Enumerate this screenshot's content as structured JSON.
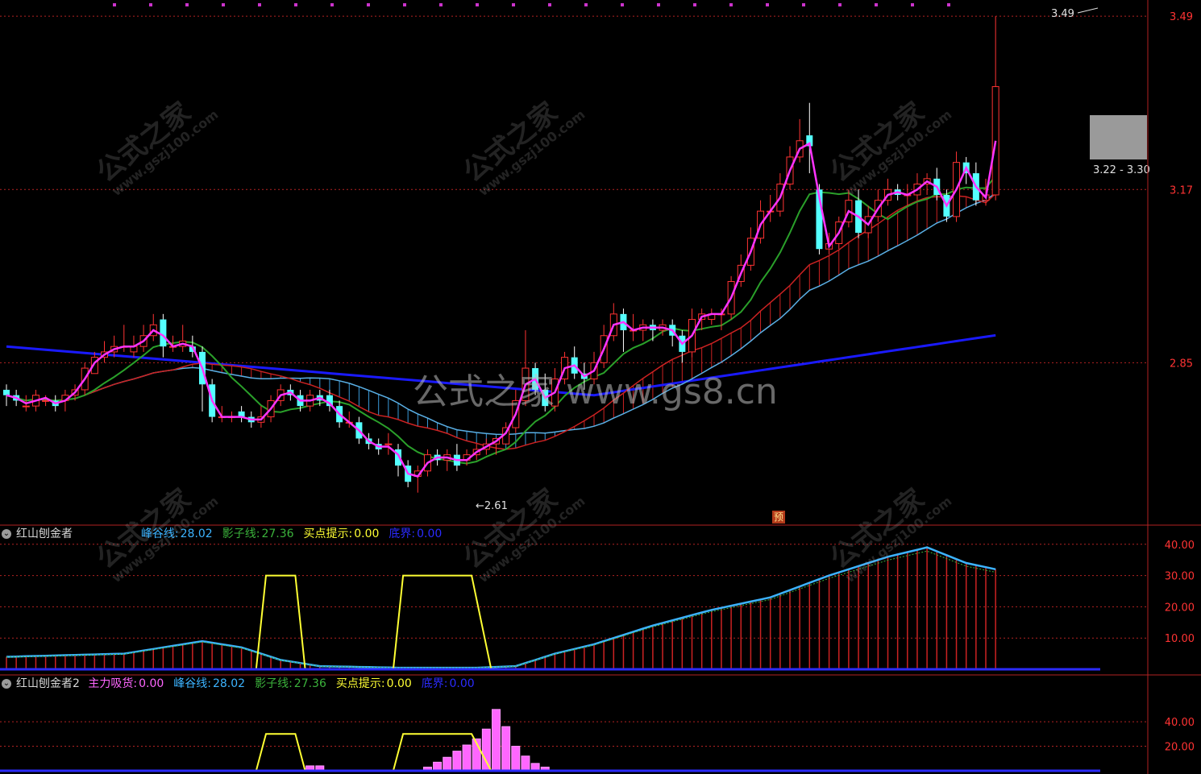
{
  "main_panel": {
    "price_axis_labels": [
      "3.49",
      "3.17",
      "2.85"
    ],
    "high_label": "3.49",
    "low_label": "2.61",
    "range_label": "3.22 - 3.30",
    "forecast_badge": "预"
  },
  "panel2": {
    "title": "红山刨金者",
    "indicators": [
      {
        "label": "峰谷线:",
        "value": "28.02",
        "color": "#3cb3ff"
      },
      {
        "label": "影子线:",
        "value": "27.36",
        "color": "#3bb23b"
      },
      {
        "label": "买点提示:",
        "value": "0.00",
        "color": "#ffff33"
      },
      {
        "label": "底界:",
        "value": "0.00",
        "color": "#2b2bff"
      }
    ],
    "axis_labels": [
      "40.00",
      "30.00",
      "20.00",
      "10.00"
    ]
  },
  "panel3": {
    "title": "红山刨金者2",
    "indicators": [
      {
        "label": "主力吸货:",
        "value": "0.00",
        "color": "#ff66ff"
      },
      {
        "label": "峰谷线:",
        "value": "28.02",
        "color": "#3cb3ff"
      },
      {
        "label": "影子线:",
        "value": "27.36",
        "color": "#3bb23b"
      },
      {
        "label": "买点提示:",
        "value": "0.00",
        "color": "#ffff33"
      },
      {
        "label": "底界:",
        "value": "0.00",
        "color": "#2b2bff"
      }
    ],
    "axis_labels": [
      "40.00",
      "20.00"
    ]
  },
  "watermarks": {
    "center": "公式之家 www.gs8.cn",
    "tile_main": "公式之家",
    "tile_sub": "www.gszj100.com"
  },
  "chart_data": [
    {
      "type": "candlestick",
      "ylim": [
        2.55,
        3.52
      ],
      "ticks": [
        3.49,
        3.17,
        2.85
      ],
      "candles": [
        [
          2.8,
          2.79,
          2.81,
          2.77
        ],
        [
          2.79,
          2.78,
          2.8,
          2.77
        ],
        [
          2.77,
          2.77,
          2.79,
          2.76
        ],
        [
          2.77,
          2.79,
          2.8,
          2.76
        ],
        [
          2.78,
          2.78,
          2.79,
          2.77
        ],
        [
          2.78,
          2.77,
          2.79,
          2.76
        ],
        [
          2.78,
          2.79,
          2.8,
          2.76
        ],
        [
          2.79,
          2.8,
          2.81,
          2.78
        ],
        [
          2.8,
          2.84,
          2.85,
          2.79
        ],
        [
          2.83,
          2.86,
          2.87,
          2.83
        ],
        [
          2.86,
          2.87,
          2.89,
          2.85
        ],
        [
          2.87,
          2.88,
          2.9,
          2.86
        ],
        [
          2.88,
          2.88,
          2.92,
          2.87
        ],
        [
          2.87,
          2.88,
          2.9,
          2.86
        ],
        [
          2.88,
          2.9,
          2.92,
          2.87
        ],
        [
          2.9,
          2.92,
          2.94,
          2.89
        ],
        [
          2.93,
          2.88,
          2.94,
          2.86
        ],
        [
          2.88,
          2.88,
          2.9,
          2.87
        ],
        [
          2.88,
          2.89,
          2.92,
          2.87
        ],
        [
          2.88,
          2.87,
          2.9,
          2.86
        ],
        [
          2.87,
          2.81,
          2.88,
          2.76
        ],
        [
          2.81,
          2.75,
          2.82,
          2.74
        ],
        [
          2.75,
          2.75,
          2.77,
          2.74
        ],
        [
          2.75,
          2.75,
          2.76,
          2.74
        ],
        [
          2.76,
          2.75,
          2.77,
          2.74
        ],
        [
          2.75,
          2.74,
          2.76,
          2.73
        ],
        [
          2.74,
          2.75,
          2.77,
          2.73
        ],
        [
          2.75,
          2.78,
          2.79,
          2.74
        ],
        [
          2.78,
          2.8,
          2.81,
          2.77
        ],
        [
          2.8,
          2.79,
          2.81,
          2.78
        ],
        [
          2.79,
          2.77,
          2.8,
          2.76
        ],
        [
          2.77,
          2.79,
          2.8,
          2.76
        ],
        [
          2.79,
          2.78,
          2.8,
          2.77
        ],
        [
          2.79,
          2.77,
          2.8,
          2.76
        ],
        [
          2.77,
          2.74,
          2.78,
          2.73
        ],
        [
          2.74,
          2.74,
          2.76,
          2.73
        ],
        [
          2.74,
          2.71,
          2.75,
          2.7
        ],
        [
          2.71,
          2.7,
          2.72,
          2.69
        ],
        [
          2.7,
          2.69,
          2.71,
          2.68
        ],
        [
          2.7,
          2.7,
          2.72,
          2.68
        ],
        [
          2.69,
          2.66,
          2.7,
          2.64
        ],
        [
          2.66,
          2.63,
          2.67,
          2.62
        ],
        [
          2.64,
          2.65,
          2.66,
          2.61
        ],
        [
          2.65,
          2.68,
          2.69,
          2.64
        ],
        [
          2.68,
          2.67,
          2.69,
          2.66
        ],
        [
          2.67,
          2.68,
          2.69,
          2.65
        ],
        [
          2.68,
          2.66,
          2.7,
          2.65
        ],
        [
          2.67,
          2.68,
          2.69,
          2.66
        ],
        [
          2.68,
          2.69,
          2.7,
          2.67
        ],
        [
          2.69,
          2.7,
          2.71,
          2.68
        ],
        [
          2.7,
          2.71,
          2.71,
          2.68
        ],
        [
          2.7,
          2.73,
          2.74,
          2.7
        ],
        [
          2.73,
          2.78,
          2.8,
          2.72
        ],
        [
          2.78,
          2.84,
          2.91,
          2.77
        ],
        [
          2.84,
          2.8,
          2.85,
          2.79
        ],
        [
          2.8,
          2.77,
          2.83,
          2.76
        ],
        [
          2.77,
          2.82,
          2.84,
          2.76
        ],
        [
          2.82,
          2.86,
          2.87,
          2.81
        ],
        [
          2.86,
          2.83,
          2.88,
          2.82
        ],
        [
          2.83,
          2.82,
          2.85,
          2.8
        ],
        [
          2.82,
          2.85,
          2.87,
          2.81
        ],
        [
          2.85,
          2.9,
          2.92,
          2.84
        ],
        [
          2.9,
          2.94,
          2.96,
          2.89
        ],
        [
          2.94,
          2.91,
          2.95,
          2.87
        ],
        [
          2.91,
          2.91,
          2.94,
          2.89
        ],
        [
          2.91,
          2.92,
          2.93,
          2.89
        ],
        [
          2.92,
          2.91,
          2.93,
          2.89
        ],
        [
          2.91,
          2.92,
          2.93,
          2.9
        ],
        [
          2.92,
          2.9,
          2.93,
          2.88
        ],
        [
          2.9,
          2.87,
          2.91,
          2.85
        ],
        [
          2.87,
          2.93,
          2.95,
          2.86
        ],
        [
          2.93,
          2.94,
          2.95,
          2.91
        ],
        [
          2.93,
          2.94,
          2.95,
          2.92
        ],
        [
          2.94,
          2.94,
          2.95,
          2.91
        ],
        [
          2.94,
          3.0,
          3.01,
          2.93
        ],
        [
          3.0,
          3.03,
          3.05,
          2.99
        ],
        [
          3.03,
          3.08,
          3.1,
          3.02
        ],
        [
          3.08,
          3.13,
          3.15,
          3.07
        ],
        [
          3.13,
          3.13,
          3.16,
          3.11
        ],
        [
          3.13,
          3.18,
          3.2,
          3.12
        ],
        [
          3.18,
          3.23,
          3.25,
          3.17
        ],
        [
          3.23,
          3.26,
          3.3,
          3.22
        ],
        [
          3.27,
          3.25,
          3.33,
          3.2
        ],
        [
          3.17,
          3.06,
          3.18,
          3.05
        ],
        [
          3.06,
          3.07,
          3.09,
          3.05
        ],
        [
          3.07,
          3.11,
          3.12,
          3.06
        ],
        [
          3.11,
          3.15,
          3.17,
          3.1
        ],
        [
          3.15,
          3.09,
          3.17,
          3.08
        ],
        [
          3.09,
          3.12,
          3.14,
          3.08
        ],
        [
          3.12,
          3.15,
          3.17,
          3.11
        ],
        [
          3.15,
          3.17,
          3.19,
          3.14
        ],
        [
          3.17,
          3.16,
          3.18,
          3.15
        ],
        [
          3.16,
          3.16,
          3.18,
          3.14
        ],
        [
          3.16,
          3.18,
          3.2,
          3.15
        ],
        [
          3.18,
          3.19,
          3.2,
          3.16
        ],
        [
          3.19,
          3.16,
          3.21,
          3.15
        ],
        [
          3.16,
          3.12,
          3.17,
          3.11
        ],
        [
          3.12,
          3.22,
          3.24,
          3.11
        ],
        [
          3.22,
          3.2,
          3.23,
          3.18
        ],
        [
          3.2,
          3.15,
          3.22,
          3.14
        ],
        [
          3.15,
          3.16,
          3.19,
          3.14
        ],
        [
          3.16,
          3.36,
          3.49,
          3.15
        ]
      ]
    },
    {
      "type": "bar",
      "name": "红山刨金者",
      "ylim": [
        0,
        42
      ],
      "ticks": [
        40,
        30,
        20,
        10
      ],
      "series": [
        {
          "name": "峰谷线",
          "type": "line",
          "keyframes": [
            [
              0,
              4
            ],
            [
              12,
              5
            ],
            [
              16,
              7
            ],
            [
              20,
              9
            ],
            [
              24,
              7
            ],
            [
              28,
              3
            ],
            [
              32,
              1
            ],
            [
              40,
              0.5
            ],
            [
              48,
              0.5
            ],
            [
              52,
              1
            ],
            [
              56,
              5
            ],
            [
              60,
              8
            ],
            [
              66,
              14
            ],
            [
              72,
              19
            ],
            [
              78,
              23
            ],
            [
              84,
              30
            ],
            [
              90,
              36
            ],
            [
              94,
              39
            ],
            [
              98,
              34
            ],
            [
              104,
              30
            ],
            [
              110,
              29
            ],
            [
              114,
              28
            ],
            [
              118,
              25
            ],
            [
              120,
              28
            ]
          ]
        },
        {
          "name": "买点提示",
          "type": "line",
          "values": [
            0,
            30,
            30,
            0,
            0,
            30,
            30,
            0
          ]
        }
      ]
    },
    {
      "type": "bar",
      "name": "红山刨金者2",
      "ylim": [
        0,
        65
      ],
      "ticks": [
        40,
        20
      ],
      "series": [
        {
          "name": "主力吸货",
          "type": "bar",
          "keyframes": [
            [
              30,
              0
            ],
            [
              31,
              4
            ],
            [
              32,
              4
            ],
            [
              33,
              0
            ],
            [
              42,
              0
            ],
            [
              43,
              3
            ],
            [
              44,
              7
            ],
            [
              45,
              11
            ],
            [
              46,
              16
            ],
            [
              47,
              21
            ],
            [
              48,
              26
            ],
            [
              49,
              34
            ],
            [
              50,
              50
            ],
            [
              51,
              36
            ],
            [
              52,
              20
            ],
            [
              53,
              12
            ],
            [
              54,
              6
            ],
            [
              55,
              3
            ],
            [
              56,
              0
            ]
          ]
        },
        {
          "name": "买点提示",
          "type": "line",
          "values": [
            0,
            30,
            30,
            0,
            0,
            30,
            30,
            0
          ]
        }
      ]
    }
  ]
}
